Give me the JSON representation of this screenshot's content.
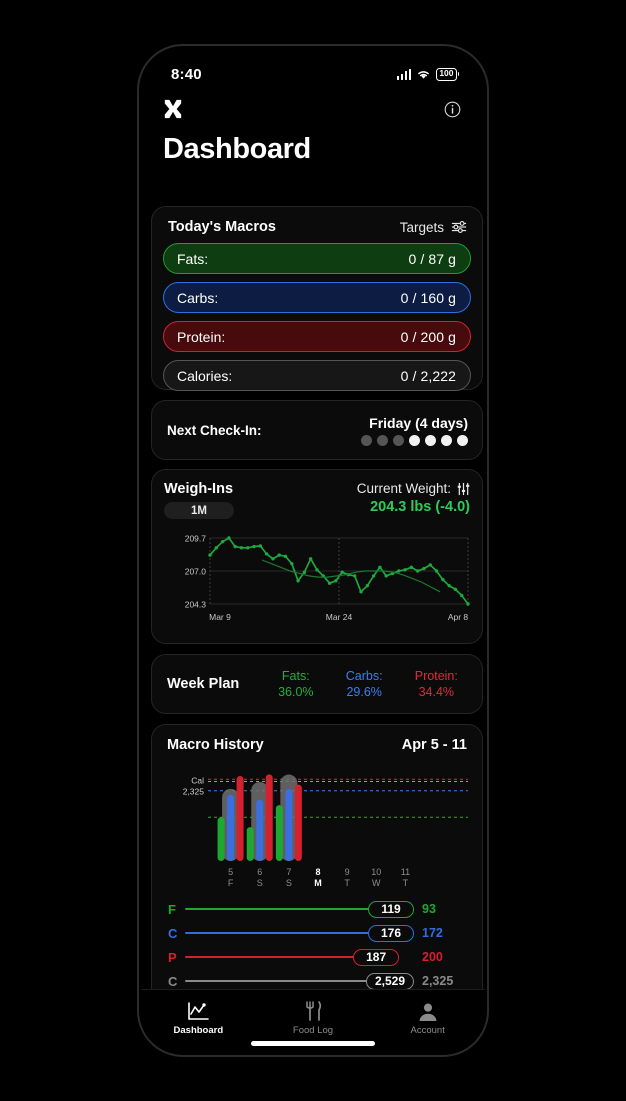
{
  "status_bar": {
    "time": "8:40",
    "battery": "100",
    "wifi_icon": "wifi-icon",
    "cellular_icon": "cellular-bars-icon"
  },
  "header": {
    "logo_icon": "app-logo-icon",
    "info_icon": "info-circle-icon",
    "title": "Dashboard"
  },
  "macros_card": {
    "title": "Today's Macros",
    "targets_label": "Targets",
    "targets_icon": "sliders-horizontal-icon",
    "rows": [
      {
        "label": "Fats:",
        "value": "0 / 87 g",
        "color": "#1f9e2a"
      },
      {
        "label": "Carbs:",
        "value": "0 / 160 g",
        "color": "#2f6fe0"
      },
      {
        "label": "Protein:",
        "value": "0 / 200 g",
        "color": "#d5202f"
      },
      {
        "label": "Calories:",
        "value": "0 / 2,222",
        "color": "#555555"
      }
    ]
  },
  "checkin_card": {
    "label": "Next Check-In:",
    "day": "Friday (4 days)",
    "dots_past": 3,
    "dots_future": 4
  },
  "weighins_card": {
    "title": "Weigh-Ins",
    "range_label": "1M",
    "current_weight_label": "Current Weight:",
    "current_weight_icon": "sliders-vertical-icon",
    "current_weight_value": "204.3 lbs (-4.0)"
  },
  "week_plan_card": {
    "title": "Week Plan",
    "columns": [
      {
        "label": "Fats:",
        "value": "36.0%",
        "color": "#22b03c"
      },
      {
        "label": "Carbs:",
        "value": "29.6%",
        "color": "#3b7ff0"
      },
      {
        "label": "Protein:",
        "value": "34.4%",
        "color": "#e02a38"
      }
    ]
  },
  "history_card": {
    "title": "Macro History",
    "date_range": "Apr 5 - 11",
    "cal_axis_label": "Cal",
    "cal_axis_value": "2,325",
    "summary": [
      {
        "label": "F",
        "value": "119",
        "goal": "93",
        "color": "#1fa831",
        "fill": 1.0
      },
      {
        "label": "C",
        "value": "176",
        "goal": "172",
        "color": "#2f6fe0",
        "fill": 1.0
      },
      {
        "label": "P",
        "value": "187",
        "goal": "200",
        "color": "#d5202f",
        "fill": 0.935
      },
      {
        "label": "C",
        "value": "2,529",
        "goal": "2,325",
        "color": "#8a8a8a",
        "fill": 1.0
      }
    ]
  },
  "tabbar": {
    "tabs": [
      {
        "label": "Dashboard",
        "icon": "line-chart-icon",
        "active": true
      },
      {
        "label": "Food Log",
        "icon": "fork-knife-icon",
        "active": false
      },
      {
        "label": "Account",
        "icon": "person-icon",
        "active": false
      }
    ]
  },
  "chart_data": [
    {
      "type": "line",
      "name": "weigh-ins",
      "title": "Weigh-Ins",
      "ylabel": "",
      "xlabel": "",
      "ylim": [
        204.3,
        209.7
      ],
      "ytick_labels": [
        "209.7",
        "207.0",
        "204.3"
      ],
      "xtick_labels": [
        "Mar 9",
        "Mar 24",
        "Apr 8"
      ],
      "grid": true,
      "series": [
        {
          "name": "weight",
          "color": "#1fa83c",
          "values": [
            208.3,
            208.9,
            209.4,
            209.7,
            209.0,
            208.9,
            208.9,
            209.0,
            209.05,
            208.4,
            208.0,
            208.3,
            208.2,
            207.6,
            206.2,
            206.9,
            208.0,
            207.1,
            206.6,
            206.0,
            206.2,
            206.9,
            206.7,
            206.6,
            205.3,
            205.8,
            206.6,
            207.3,
            206.6,
            206.8,
            207.0,
            207.1,
            207.3,
            207.0,
            207.2,
            207.5,
            207.0,
            206.3,
            205.8,
            205.5,
            205.0,
            204.3
          ]
        },
        {
          "name": "trend",
          "color": "#1a7a33",
          "values": [
            207.9,
            207.6,
            207.3,
            207.0,
            206.8,
            206.6,
            206.5,
            206.5,
            206.6,
            206.7,
            206.9,
            207.0,
            207.0,
            207.0,
            206.9,
            206.7,
            206.4,
            206.1,
            205.7,
            205.3
          ]
        }
      ]
    },
    {
      "type": "bar",
      "name": "macro-history",
      "title": "Macro History",
      "date_range": "Apr 5 - 11",
      "categories": [
        "5",
        "6",
        "7",
        "8",
        "9",
        "10",
        "11"
      ],
      "category_subs": [
        "F",
        "S",
        "S",
        "M",
        "T",
        "W",
        "T"
      ],
      "today_index": 3,
      "reference_lines": [
        {
          "label": "P 200",
          "value": 200,
          "color": "#e02a38",
          "key": "protein"
        },
        {
          "label": "cal",
          "value": 2325,
          "color": "#9a9a9a",
          "key": "calories"
        },
        {
          "label": "C 172",
          "value": 172,
          "color": "#3b7ff0",
          "key": "carbs"
        },
        {
          "label": "F 93",
          "value": 93,
          "color": "#22b03c",
          "key": "fats"
        }
      ],
      "series": [
        {
          "name": "Fats",
          "color": "#1fa831",
          "values": [
            93,
            72,
            119,
            null,
            null,
            null,
            null
          ],
          "max": 200
        },
        {
          "name": "Calories",
          "color": "#6e6e6e",
          "values": [
            2110,
            2310,
            2529,
            null,
            null,
            null,
            null
          ],
          "max": 2750
        },
        {
          "name": "Carbs",
          "color": "#3b6fe0",
          "values": [
            162,
            150,
            176,
            null,
            null,
            null,
            null
          ],
          "max": 230
        },
        {
          "name": "Protein",
          "color": "#d5202f",
          "values": [
            208,
            212,
            187,
            null,
            null,
            null,
            null
          ],
          "max": 230
        }
      ]
    }
  ]
}
